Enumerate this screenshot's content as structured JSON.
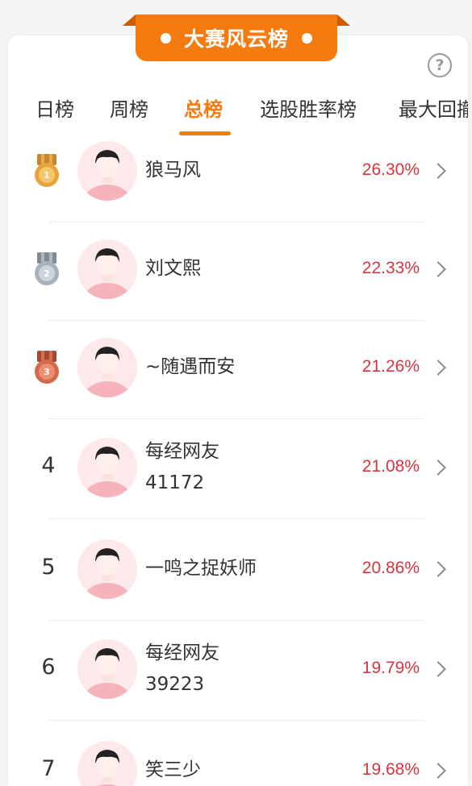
{
  "header": {
    "title": "大赛风云榜",
    "help_symbol": "?"
  },
  "tabs": [
    {
      "label": "日榜"
    },
    {
      "label": "周榜"
    },
    {
      "label": "总榜",
      "active": true
    },
    {
      "label": "选股胜率榜"
    },
    {
      "label": "最大回撤"
    }
  ],
  "colors": {
    "accent": "#f47b10",
    "percent": "#d9343f",
    "gold": "#e8a33c",
    "silver": "#a7b1bc",
    "bronze": "#d36a4b"
  },
  "rows": [
    {
      "rank": "1",
      "medal": "gold",
      "name_line1": "狼马风",
      "name_line2": "",
      "percent": "26.30%"
    },
    {
      "rank": "2",
      "medal": "silver",
      "name_line1": "刘文熙",
      "name_line2": "",
      "percent": "22.33%"
    },
    {
      "rank": "3",
      "medal": "bronze",
      "name_line1": "~随遇而安",
      "name_line2": "",
      "percent": "21.26%"
    },
    {
      "rank": "4",
      "medal": "",
      "name_line1": "每经网友",
      "name_line2": "41172",
      "percent": "21.08%"
    },
    {
      "rank": "5",
      "medal": "",
      "name_line1": "一鸣之捉妖师",
      "name_line2": "",
      "percent": "20.86%"
    },
    {
      "rank": "6",
      "medal": "",
      "name_line1": "每经网友",
      "name_line2": "39223",
      "percent": "19.79%"
    },
    {
      "rank": "7",
      "medal": "",
      "name_line1": "笑三少",
      "name_line2": "",
      "percent": "19.68%"
    }
  ]
}
